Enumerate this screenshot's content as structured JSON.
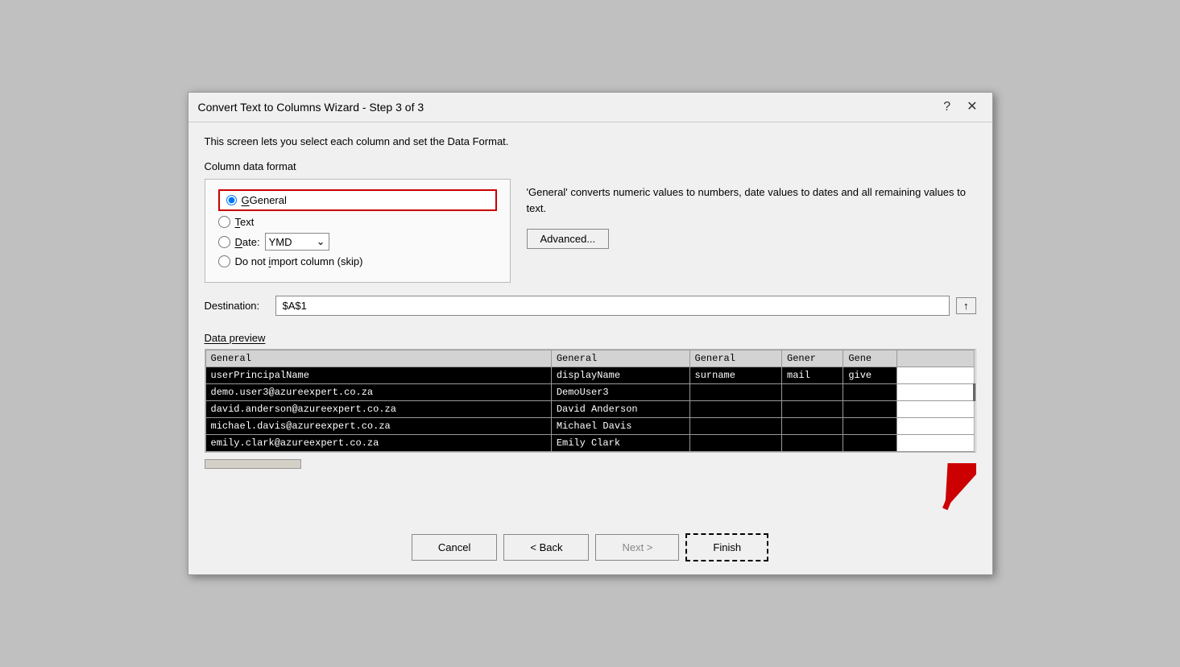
{
  "dialog": {
    "title": "Convert Text to Columns Wizard - Step 3 of 3",
    "help_btn": "?",
    "close_btn": "✕"
  },
  "description": "This screen lets you select each column and set the Data Format.",
  "column_format": {
    "label": "Column data format",
    "options": [
      {
        "id": "general",
        "label": "General",
        "selected": true
      },
      {
        "id": "text",
        "label": "Text",
        "selected": false
      },
      {
        "id": "date",
        "label": "Date:",
        "selected": false
      },
      {
        "id": "skip",
        "label": "Do not import column (skip)",
        "selected": false
      }
    ],
    "date_value": "YMD"
  },
  "general_description": "'General' converts numeric values to numbers, date values to dates and all remaining values to text.",
  "advanced_btn_label": "Advanced...",
  "destination": {
    "label": "Destination:",
    "value": "$A$1",
    "btn_icon": "↑"
  },
  "preview": {
    "label": "Data preview",
    "headers": [
      "General",
      "General",
      "General",
      "Gener",
      "Gene"
    ],
    "rows": [
      [
        "userPrincipalName",
        "displayName",
        "surname",
        "mail",
        "give"
      ],
      [
        "demo.user3@azureexpert.co.za",
        "DemoUser3",
        "",
        "",
        ""
      ],
      [
        "david.anderson@azureexpert.co.za",
        "David Anderson",
        "",
        "",
        ""
      ],
      [
        "michael.davis@azureexpert.co.za",
        "Michael Davis",
        "",
        "",
        ""
      ],
      [
        "emily.clark@azureexpert.co.za",
        "Emily Clark",
        "",
        "",
        ""
      ]
    ]
  },
  "buttons": {
    "cancel": "Cancel",
    "back": "< Back",
    "next": "Next >",
    "finish": "Finish"
  }
}
